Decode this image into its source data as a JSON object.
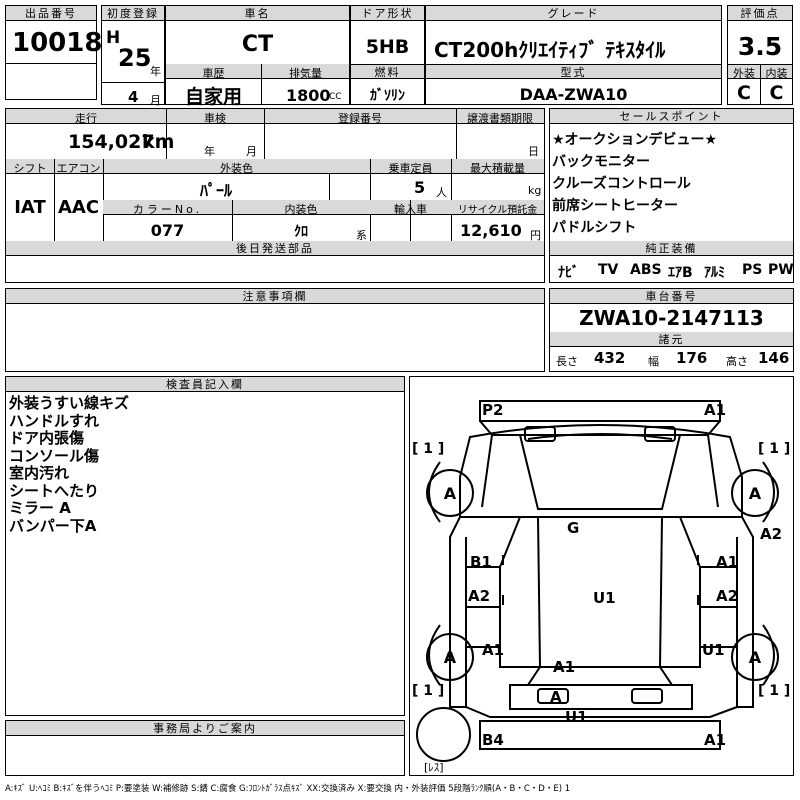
{
  "header": {
    "lot_label": "出品番号",
    "lot": "10018",
    "first_reg_label": "初度登録",
    "era": "H",
    "reg_year": "25",
    "year_unit": "年",
    "reg_month": "4",
    "month_unit": "月",
    "name_label": "車名",
    "name": "CT",
    "history_label": "車歴",
    "history": "自家用",
    "displacement_label": "排気量",
    "displacement": "1800",
    "cc": "CC",
    "door_label": "ドア形状",
    "door": "5HB",
    "fuel_label": "燃料",
    "fuel": "ｶﾞｿﾘﾝ",
    "grade_label": "グレード",
    "grade": "CT200hｸﾘｴｲﾃｨﾌﾞ ﾃｷｽﾀｲﾙ",
    "model_label": "型式",
    "model": "DAA-ZWA10",
    "score_label": "評価点",
    "score": "3.5",
    "exterior_label": "外装",
    "exterior": "C",
    "interior_label": "内装",
    "interior": "C"
  },
  "row2": {
    "mileage_label": "走行",
    "mileage": "154,027",
    "km": "km",
    "inspection_label": "車検",
    "insp_year": "年",
    "insp_month": "月",
    "regno_label": "登録番号",
    "deadline_label": "譲渡書類期限",
    "deadline_day": "日",
    "shift_label": "シフト",
    "shift": "IAT",
    "ac_label": "エアコン",
    "ac": "AAC",
    "color_label": "外装色",
    "color": "ﾊﾟｰﾙ",
    "capacity_label": "乗車定員",
    "capacity": "5",
    "person": "人",
    "maxload_label": "最大積載量",
    "kg": "kg",
    "colorno_label": "カラーNo.",
    "colorno": "077",
    "intcolor_label": "内装色",
    "intcolor": "ｸﾛ",
    "kei": "系",
    "import_label": "輸入車",
    "recycle_label": "リサイクル預託金",
    "recycle": "12,610",
    "yen": "円",
    "later_label": "後日発送部品"
  },
  "sales": {
    "label": "セールスポイント",
    "items": [
      "★オークションデビュー★",
      "バックモニター",
      "クルーズコントロール",
      "前席シートヒーター",
      "パドルシフト"
    ]
  },
  "equipment": {
    "label": "純正装備",
    "items": [
      "ﾅﾋﾞ",
      "TV",
      "ABS",
      "ｴｱB",
      "ｱﾙﾐ",
      "PS",
      "PW"
    ]
  },
  "notes": {
    "label": "注意事項欄"
  },
  "chassis": {
    "label": "車台番号",
    "number": "ZWA10-2147113",
    "spec_label": "諸元",
    "length_label": "長さ",
    "length": "432",
    "width_label": "幅",
    "width": "176",
    "height_label": "高さ",
    "height": "146"
  },
  "inspector": {
    "label": "検査員記入欄",
    "lines": [
      "外装うすい線キズ",
      "ハンドルすれ",
      "ドア内張傷",
      "コンソール傷",
      "室内汚れ",
      "シートへたり",
      "ミラー A",
      "バンパー下A"
    ]
  },
  "office": {
    "label": "事務局よりご案内"
  },
  "diagram": {
    "p2": "P2",
    "a1_tr": "A1",
    "brk_tl": "[ 1 ]",
    "brk_tr": "[ 1 ]",
    "brk_bl": "[ 1 ]",
    "brk_br": "[ 1 ]",
    "w_tl": "A",
    "w_tr": "A",
    "w_bl": "A",
    "w_br": "A",
    "a2_right": "A2",
    "g": "G",
    "b1": "B1",
    "a1_right_upper": "A1",
    "a2_left": "A2",
    "u1_center": "U1",
    "a2_right_mid": "A2",
    "a1_left_low": "A1",
    "u1_right_low": "U1",
    "a1_bottom": "A1",
    "a_bottom": "A",
    "u1_bottom": "U1",
    "b4": "B4",
    "a1_br": "A1",
    "spare": "[ﾚｽ]"
  },
  "legend": {
    "text": "A:ｷｽﾞ U:ﾍｺﾐ B:ｷｽﾞを伴うﾍｺﾐ P:要塗装 W:補修跡 S:錆 C:腐食 G:ﾌﾛﾝﾄｶﾞﾗｽ点ｷｽﾞ XX:交換済み X:要交換 内・外装評価 5段階ﾗﾝｸ順(A・B・C・D・E) 1"
  }
}
